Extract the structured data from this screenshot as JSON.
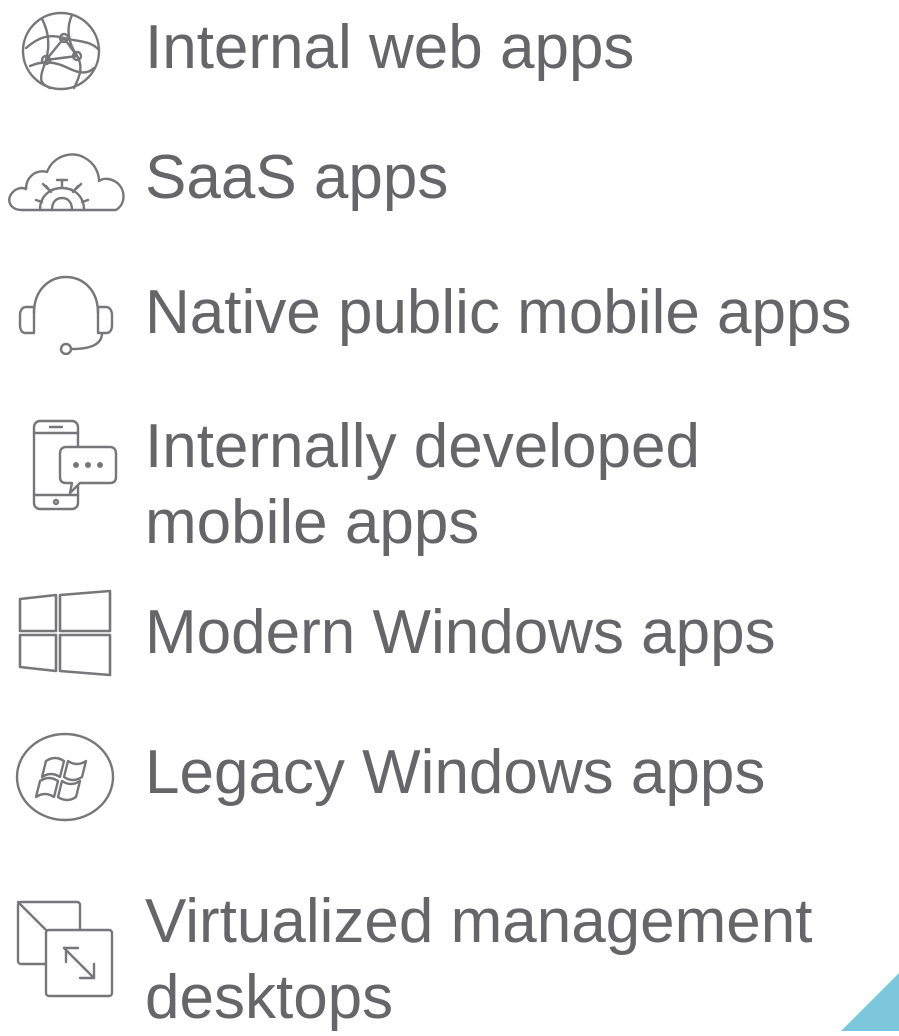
{
  "items": [
    {
      "icon": "globe-icon",
      "label": "Internal web apps"
    },
    {
      "icon": "cloud-gear-icon",
      "label": "SaaS apps"
    },
    {
      "icon": "headset-icon",
      "label": "Native public mobile apps"
    },
    {
      "icon": "mobile-chat-icon",
      "lines": [
        "Internally developed",
        "mobile apps"
      ]
    },
    {
      "icon": "windows-logo-icon",
      "label": "Modern Windows apps"
    },
    {
      "icon": "legacy-windows-logo-icon",
      "label": "Legacy Windows apps"
    },
    {
      "icon": "virtual-desktop-icon",
      "lines": [
        "Virtualized management",
        "desktops"
      ]
    }
  ],
  "colors": {
    "text": "#666668",
    "icon_stroke": "#77777a",
    "accent": "#7cc7dc"
  }
}
